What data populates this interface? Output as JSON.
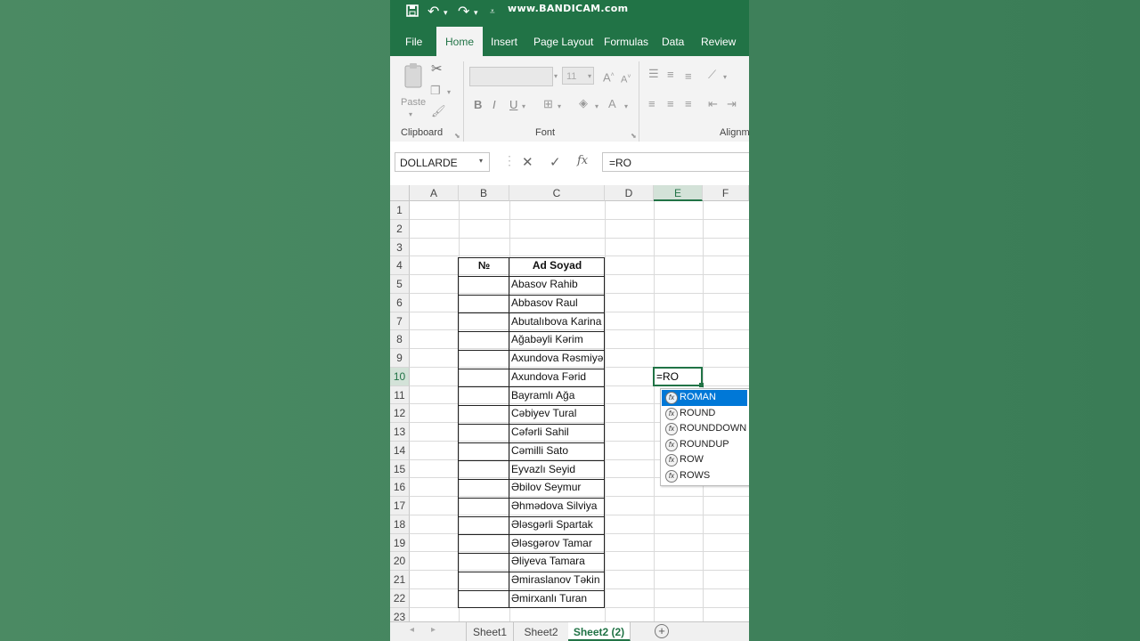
{
  "watermark": "www.BANDICAM.com",
  "ribbon_tabs": [
    {
      "label": "File",
      "active": false
    },
    {
      "label": "Home",
      "active": true
    },
    {
      "label": "Insert",
      "active": false
    },
    {
      "label": "Page Layout",
      "active": false
    },
    {
      "label": "Formulas",
      "active": false
    },
    {
      "label": "Data",
      "active": false
    },
    {
      "label": "Review",
      "active": false
    }
  ],
  "ribbon": {
    "paste_label": "Paste",
    "font_size": "11",
    "groups": {
      "clipboard": "Clipboard",
      "font": "Font",
      "alignment": "Alignm"
    },
    "bold": "B",
    "italic": "I",
    "underline": "U"
  },
  "formula_bar": {
    "name_box": "DOLLARDE",
    "formula": "=RO",
    "cancel": "✕",
    "enter": "✓",
    "fx": "fx"
  },
  "columns": [
    "A",
    "B",
    "C",
    "D",
    "E",
    "F"
  ],
  "rows": [
    "1",
    "2",
    "3",
    "4",
    "5",
    "6",
    "7",
    "8",
    "9",
    "10",
    "11",
    "12",
    "13",
    "14",
    "15",
    "16",
    "17",
    "18",
    "19",
    "20",
    "21",
    "22",
    "23"
  ],
  "table": {
    "header_no": "№",
    "header_name": "Ad Soyad",
    "names": [
      "Abasov Rahib",
      "Abbasov Raul",
      "Abutalıbova Karina",
      "Ağabəyli Kərim",
      "Axundova Rəsmiyə",
      "Axundova Fərid",
      "Bayramlı Ağa",
      "Cəbiyev Tural",
      "Cəfərli Sahil",
      "Cəmilli Sato",
      "Eyvazlı Seyid",
      "Əbilov Seymur",
      "Əhmədova Silviya",
      "Ələsgərli Spartak",
      "Ələsgərov Tamar",
      "Əliyeva Tamara",
      "Əmiraslanov Təkin",
      "Əmirxanlı Turan"
    ]
  },
  "active_cell": {
    "ref": "E10",
    "content": "=RO"
  },
  "autocomplete": [
    {
      "label": "ROMAN",
      "selected": true
    },
    {
      "label": "ROUND",
      "selected": false
    },
    {
      "label": "ROUNDDOWN",
      "selected": false
    },
    {
      "label": "ROUNDUP",
      "selected": false
    },
    {
      "label": "ROW",
      "selected": false
    },
    {
      "label": "ROWS",
      "selected": false
    }
  ],
  "sheet_tabs": [
    {
      "label": "Sheet1",
      "active": false
    },
    {
      "label": "Sheet2",
      "active": false
    },
    {
      "label": "Sheet2 (2)",
      "active": true
    }
  ],
  "colors": {
    "accent": "#217346",
    "selection": "#0078d7"
  }
}
